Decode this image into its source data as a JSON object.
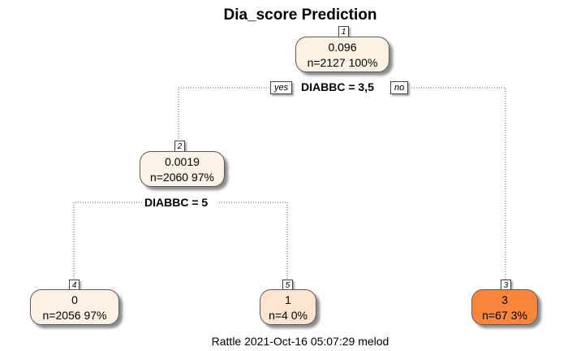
{
  "title": "Dia_score Prediction",
  "footer": "Rattle 2021-Oct-16 05:07:29 melod",
  "colors": {
    "node_1": "#fdf1e4",
    "node_2": "#fdf2e6",
    "node_4": "#fdf1e4",
    "node_5": "#fde4cf",
    "node_3": "#f9863a",
    "edge": "#555555"
  },
  "nodes": {
    "n1": {
      "id": "1",
      "value": "0.096",
      "count": "n=2127  100%"
    },
    "n2": {
      "id": "2",
      "value": "0.0019",
      "count": "n=2060  97%"
    },
    "n4": {
      "id": "4",
      "value": "0",
      "count": "n=2056  97%"
    },
    "n5": {
      "id": "5",
      "value": "1",
      "count": "n=4  0%"
    },
    "n3": {
      "id": "3",
      "value": "3",
      "count": "n=67  3%"
    }
  },
  "splits": {
    "root": "DIABBC = 3,5",
    "node2": "DIABBC = 5"
  },
  "branch_labels": {
    "yes": "yes",
    "no": "no"
  }
}
